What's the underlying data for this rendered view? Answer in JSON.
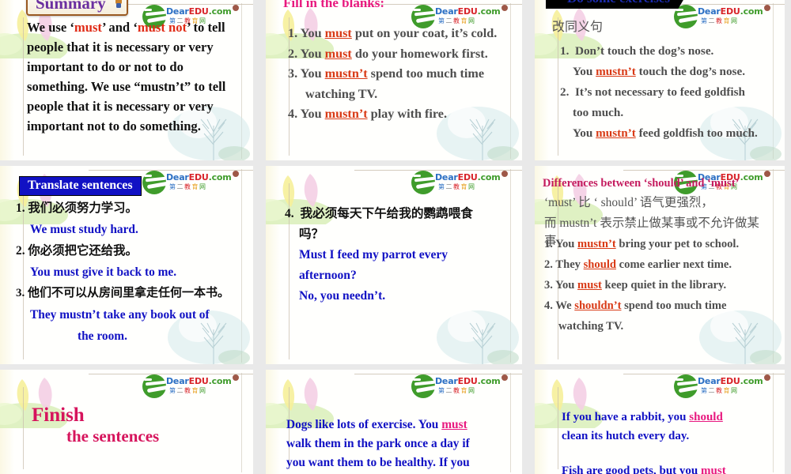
{
  "deck": {
    "logo": {
      "brand_dear": "Dear",
      "brand_edu": "EDU",
      "brand_dot_com": ".com",
      "cn_chars": [
        "第",
        "二",
        "教",
        "育",
        "网"
      ]
    }
  },
  "slides": [
    {
      "id": "summary",
      "title": "Summary",
      "lines": [
        "We use ‘must’ and ‘must not’ to tell",
        "people that it is necessary or very",
        "important to do or not to do",
        "something. We use “mustn’t” to tell",
        "people that it is necessary or very",
        "important not to do something."
      ],
      "highlight_1": "must",
      "highlight_2": "must not"
    },
    {
      "id": "fill-in-the-blanks",
      "title": "Fill in the blanks:",
      "items": [
        {
          "num": "1.",
          "pre": "You ",
          "key": "must",
          "post": " put on your coat, it’s cold."
        },
        {
          "num": "2.",
          "pre": "You ",
          "key": "must",
          "post": " do your homework first."
        },
        {
          "num": "3.",
          "pre": "You ",
          "key": "mustn’t",
          "post": " spend too much time",
          "cont": "watching TV."
        },
        {
          "num": "4.",
          "pre": "You ",
          "key": "mustn’t",
          "post": " play with fire."
        }
      ]
    },
    {
      "id": "do-some-exercises",
      "title": "Do some exercises",
      "subtitle": "改同义句",
      "items": [
        {
          "num": "1.",
          "prompt": "Don’t touch the dog’s nose.",
          "ans_pre": "You ",
          "ans_key": "mustn’t",
          "ans_post": " touch the dog’s nose."
        },
        {
          "num": "2.",
          "prompt": "It’s not necessary to feed goldfish",
          "prompt2": "too much.",
          "ans_pre": "You ",
          "ans_key": "mustn’t",
          "ans_post": " feed goldfish too much."
        }
      ]
    },
    {
      "id": "translate-sentences",
      "title": "Translate sentences",
      "items": [
        {
          "num": "1.",
          "cn": "我们必须努力学习。",
          "en": "We must study hard."
        },
        {
          "num": "2.",
          "cn": "你必须把它还给我。",
          "en": "You must give it back to me."
        },
        {
          "num": "3.",
          "cn": "他们不可以从房间里拿走任何一本书。",
          "en": "They mustn’t take any book out of",
          "en2": "the room."
        }
      ]
    },
    {
      "id": "translate-sentences-4",
      "items": [
        {
          "num": "4.",
          "cn": "我必须每天下午给我的鹦鹉喂食",
          "cn2": "吗？",
          "en": "Must I feed my parrot every",
          "en2": "afternoon?",
          "en3": "No, you needn’t."
        }
      ]
    },
    {
      "id": "differences-should-must",
      "title": "Differences between ‘should’ and ‘must’",
      "cn_lines": [
        "‘must’  比 ‘ should’  语气更强烈，",
        "而 mustn’t 表示禁止做某事或不允许做某",
        "事"
      ],
      "items": [
        {
          "num": "1.",
          "pre": "You ",
          "key": "mustn’t",
          "post": " bring your pet to school."
        },
        {
          "num": "2.",
          "pre": "They ",
          "key": "should",
          "post": " come earlier next time."
        },
        {
          "num": "3.",
          "pre": "You ",
          "key": "must",
          "post": " keep quiet in the library."
        },
        {
          "num": "4.",
          "pre": "We ",
          "key": "shouldn’t",
          "post": " spend too much time",
          "cont": "watching TV."
        }
      ]
    },
    {
      "id": "finish-the-sentences",
      "title_line1": "Finish",
      "title_line2": "the sentences"
    },
    {
      "id": "dogs-exercise",
      "pre": "Dogs like lots of exercise. You ",
      "key": "must",
      "lines": [
        "walk them in the park once a day if",
        "you want them to be healthy. If you"
      ]
    },
    {
      "id": "rabbit-fish",
      "pre": "If you have a rabbit, you ",
      "key": "should",
      "line2": "clean its hutch every day.",
      "line3_pre": "Fish are good pets, but you ",
      "line3_key": "must"
    }
  ],
  "colors": {
    "red_highlight": "#d93a16",
    "blue_text": "#1111c4",
    "pink_heading": "#e8197f",
    "crimson_heading": "#c41b5e",
    "purple_title": "#6b2fa0",
    "logo_green": "#3f9c2b",
    "gutter_gray": "#e9e9e9"
  }
}
